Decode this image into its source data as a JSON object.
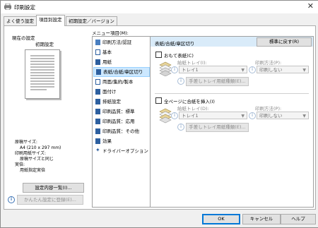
{
  "window": {
    "title": "印刷設定",
    "close_glyph": "✕"
  },
  "tabs": [
    "よく使う設定",
    "項目別設定",
    "初期設定／バージョン"
  ],
  "left": {
    "current_settings_label": "現在の設定",
    "preview_caption": "初期設定",
    "summary": [
      "原稿サイズ:",
      "A4 (210 x 297 mm)",
      "印刷用紙サイズ:",
      "原稿サイズと同じ",
      "実倍:",
      "用紙指定実倍"
    ],
    "list_button": "設定内容一覧(I)...",
    "register_button": "かんたん設定に登録(E)..."
  },
  "menu": {
    "label": "メニュー項目(M):",
    "items": [
      {
        "label": "印刷方法/認証",
        "icon": "print-method-icon"
      },
      {
        "label": "基本",
        "icon": "basic-icon"
      },
      {
        "label": "用紙",
        "icon": "paper-icon"
      },
      {
        "label": "表紙/合紙/章区切り",
        "icon": "cover-icon"
      },
      {
        "label": "両面/集約/製本",
        "icon": "duplex-icon"
      },
      {
        "label": "面付け",
        "icon": "imposition-icon"
      },
      {
        "label": "排紙設定",
        "icon": "output-icon"
      },
      {
        "label": "印刷品質：標準",
        "icon": "quality-icon"
      },
      {
        "label": "印刷品質：応用",
        "icon": "quality-advanced-icon"
      },
      {
        "label": "印刷品質：その他",
        "icon": "quality-other-icon"
      },
      {
        "label": "効果",
        "icon": "effect-icon"
      },
      {
        "label": "ドライバーオプション",
        "icon": "driver-option-icon"
      }
    ],
    "selected_index": 3
  },
  "right": {
    "header": "表紙/合紙/章区切り",
    "defaults_button": "標準に戻す(R)",
    "cover": {
      "checkbox": "おもて表紙(C)",
      "tray_label": "給紙トレイ(I):",
      "tray_value": "トレイ1",
      "method_label": "印刷方法(P):",
      "method_value": "印刷しない",
      "manual_button": "手差しトレイ用紙種類(E)..."
    },
    "slip": {
      "checkbox": "全ページに合紙を挿入(I)",
      "tray_label": "給紙トレイ(D):",
      "tray_value": "トレイ1",
      "method_label": "印刷方法(P):",
      "method_value": "印刷しない",
      "manual_button": "手差しトレイ用紙種類(E)..."
    }
  },
  "footer": {
    "ok": "OK",
    "cancel": "キャンセル",
    "help": "ヘルプ"
  },
  "colors": {
    "accent": "#0078d7",
    "selected_bg": "#cce8ff",
    "header_bg": "#d9ebf9"
  }
}
